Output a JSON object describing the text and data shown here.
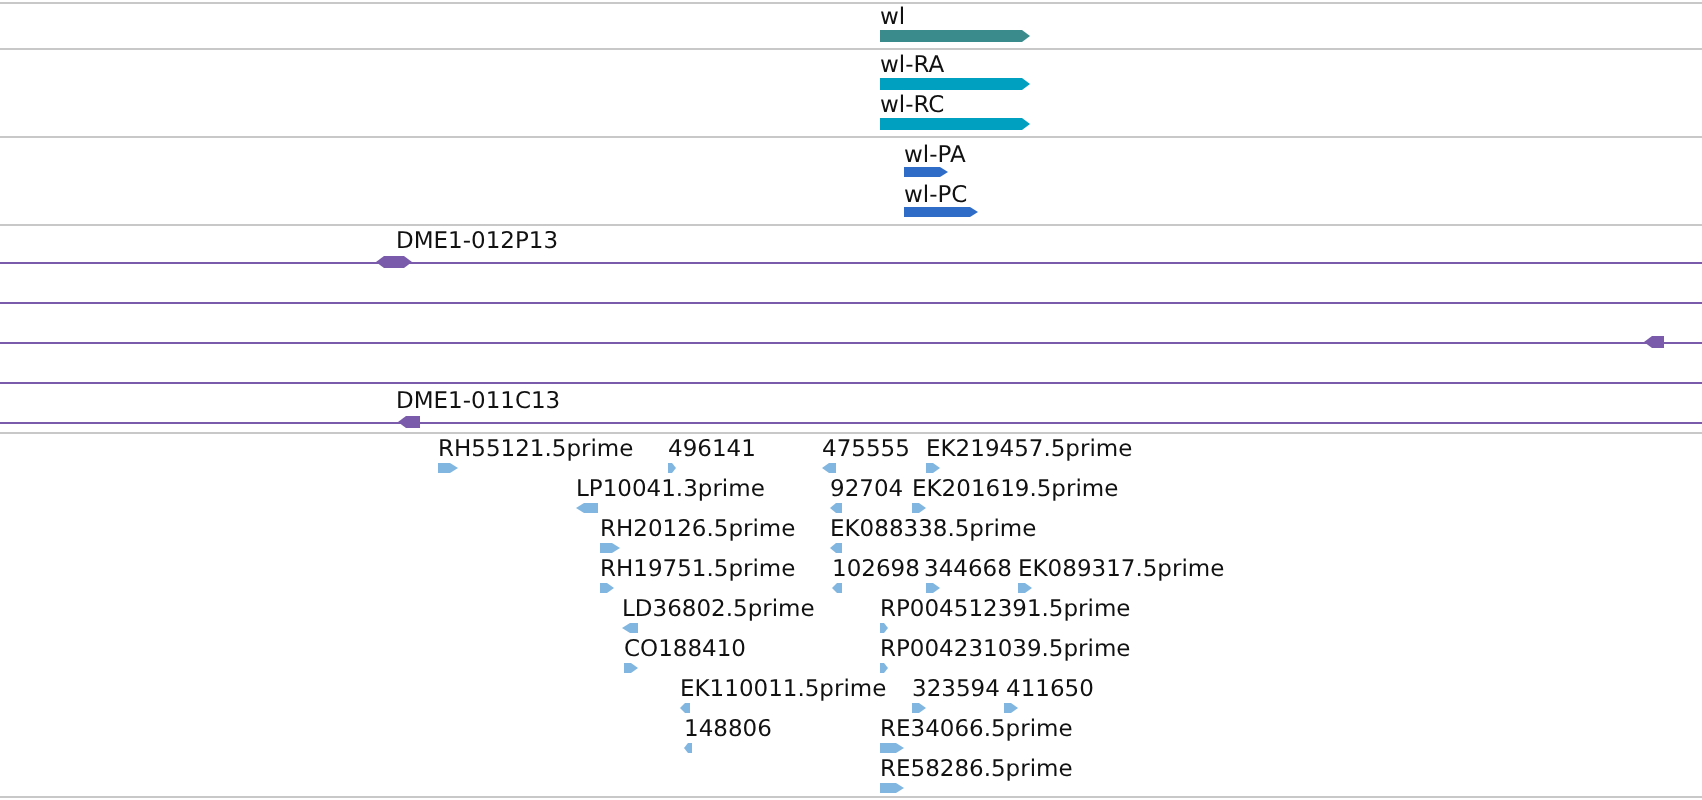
{
  "tracks": [
    {
      "kind": "gene",
      "color": "#3a8c8c",
      "features": [
        {
          "label": "wl",
          "kind": "forward"
        }
      ]
    },
    {
      "kind": "transcript",
      "color": "#00a0c0",
      "features": [
        {
          "label": "wl-RA",
          "kind": "forward"
        },
        {
          "label": "wl-RC",
          "kind": "forward"
        }
      ]
    },
    {
      "kind": "protein",
      "color": "#2f6cc8",
      "features": [
        {
          "label": "wl-PA",
          "kind": "forward"
        },
        {
          "label": "wl-PC",
          "kind": "forward"
        }
      ]
    },
    {
      "kind": "clone",
      "color": "#7a5aaa",
      "features": [
        {
          "label": "DME1-012P13",
          "kind": "both"
        },
        {
          "kind": "reverse"
        },
        {
          "label": "DME1-011C13",
          "kind": "reverse"
        }
      ]
    },
    {
      "kind": "est",
      "color": "#80b6e0",
      "features": [
        {
          "label": "RH55121.5prime",
          "kind": "forward"
        },
        {
          "label": "496141",
          "kind": "forward"
        },
        {
          "label": "475555",
          "kind": "reverse"
        },
        {
          "label": "EK219457.5prime",
          "kind": "forward"
        },
        {
          "label": "LP10041.3prime",
          "kind": "reverse"
        },
        {
          "label": "92704",
          "kind": "reverse"
        },
        {
          "label": "EK201619.5prime",
          "kind": "forward"
        },
        {
          "label": "RH20126.5prime",
          "kind": "forward"
        },
        {
          "label": "EK088338.5prime",
          "kind": "reverse"
        },
        {
          "label": "RH19751.5prime",
          "kind": "forward"
        },
        {
          "label": "102698",
          "kind": "reverse"
        },
        {
          "label": "344668",
          "kind": "forward"
        },
        {
          "label": "EK089317.5prime",
          "kind": "forward"
        },
        {
          "label": "LD36802.5prime",
          "kind": "reverse"
        },
        {
          "label": "RP004512391.5prime",
          "kind": "forward"
        },
        {
          "label": "CO188410",
          "kind": "forward"
        },
        {
          "label": "RP004231039.5prime",
          "kind": "forward"
        },
        {
          "label": "EK110011.5prime",
          "kind": "reverse"
        },
        {
          "label": "323594",
          "kind": "forward"
        },
        {
          "label": "411650",
          "kind": "forward"
        },
        {
          "label": "148806",
          "kind": "reverse"
        },
        {
          "label": "RE34066.5prime",
          "kind": "forward"
        },
        {
          "label": "RE58286.5prime",
          "kind": "forward"
        }
      ]
    }
  ]
}
